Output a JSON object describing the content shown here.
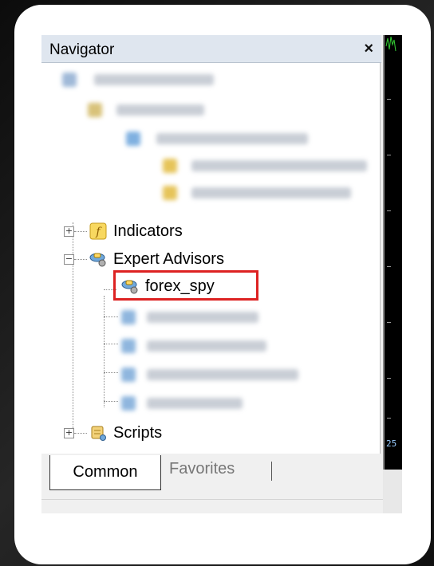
{
  "navigator": {
    "title": "Navigator",
    "close_label": "×"
  },
  "tree": {
    "indicators": "Indicators",
    "expert_advisors": "Expert Advisors",
    "selected_ea": "forex_spy",
    "scripts": "Scripts",
    "expand_plus": "+",
    "collapse_minus": "−"
  },
  "tabs": {
    "common": "Common",
    "favorites": "Favorites"
  },
  "chart": {
    "axis_label": "25"
  },
  "colors": {
    "highlight": "#dd2222",
    "chart_bg": "#000000",
    "chart_line": "#33cc33"
  }
}
